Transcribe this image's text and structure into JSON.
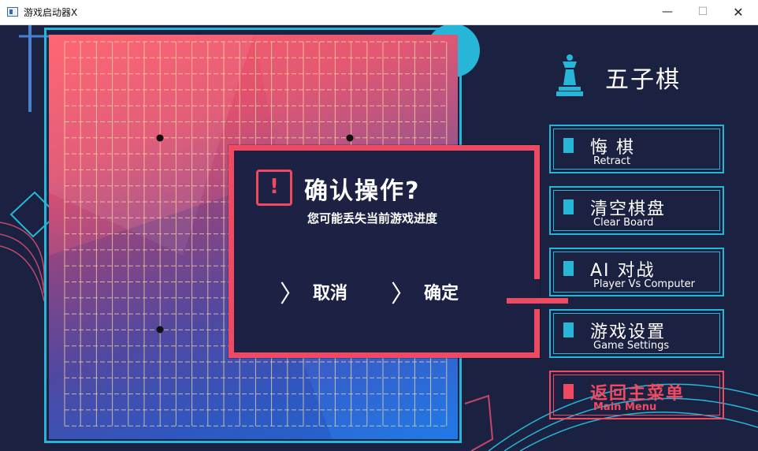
{
  "window": {
    "title": "游戏启动器X",
    "controls": {
      "minimize": "—",
      "maximize": "☐",
      "close": "✕"
    }
  },
  "header": {
    "title": "五子棋",
    "icon": "chess-queen-icon"
  },
  "dialog": {
    "title": "确认操作?",
    "subtitle": "您可能丢失当前游戏进度",
    "icon_symbol": "!",
    "cancel_label": "取消",
    "confirm_label": "确定",
    "chevron": "〉"
  },
  "menu": {
    "retract": {
      "label": "悔  棋",
      "sub": "Retract"
    },
    "clear": {
      "label": "清空棋盘",
      "sub": "Clear Board"
    },
    "ai": {
      "label": "AI  对战",
      "sub": "Player Vs Computer"
    },
    "settings": {
      "label": "游戏设置",
      "sub": "Game Settings"
    },
    "main_menu": {
      "label": "返回主菜单",
      "sub": "Main Menu"
    }
  },
  "colors": {
    "background": "#1b2140",
    "accent_cyan": "#27b6d8",
    "accent_red": "#ef4a62"
  }
}
